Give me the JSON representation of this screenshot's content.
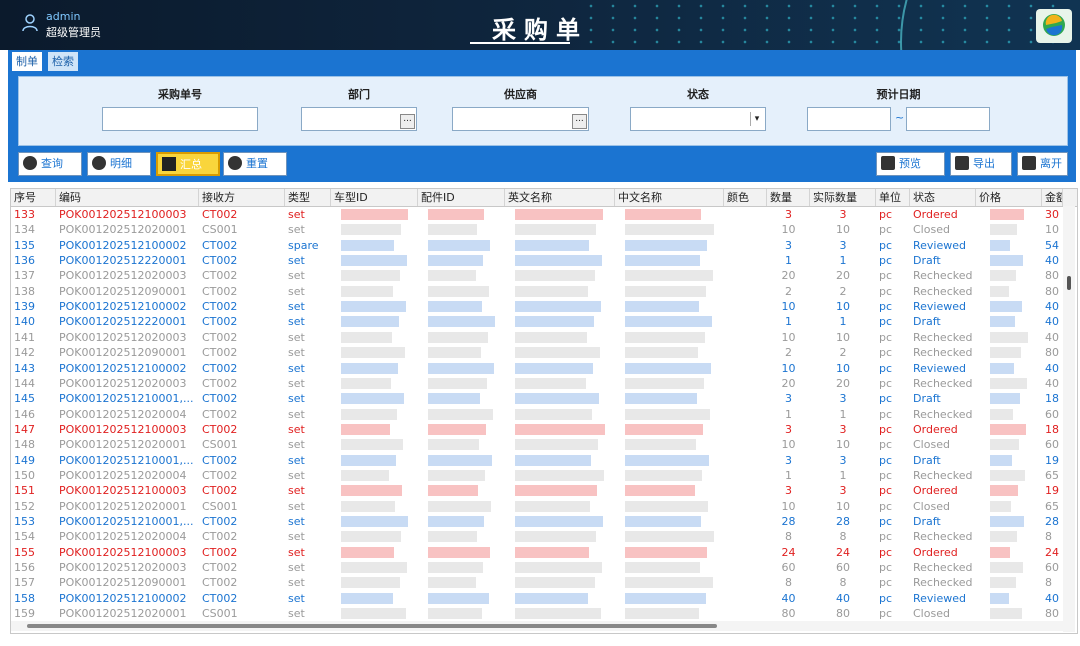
{
  "header": {
    "user_name": "admin",
    "user_role": "超级管理员",
    "title": "采购单"
  },
  "tabs": [
    {
      "label": "制单",
      "active": true
    },
    {
      "label": "检索",
      "active": false
    }
  ],
  "filters": {
    "purchase_no_label": "采购单号",
    "department_label": "部门",
    "supplier_label": "供应商",
    "status_label": "状态",
    "expected_date_label": "预计日期",
    "date_separator": "~",
    "browse_glyph": "...",
    "dropdown_glyph": "▾"
  },
  "toolbar": {
    "query": "查询",
    "detail": "明细",
    "summary": "汇总",
    "reset": "重置",
    "preview": "预览",
    "export": "导出",
    "leave": "离开"
  },
  "columns": [
    "序号",
    "编码",
    "接收方",
    "类型",
    "车型ID",
    "配件ID",
    "英文名称",
    "中文名称",
    "颜色",
    "数量",
    "实际数量",
    "单位",
    "状态",
    "价格",
    "金额"
  ],
  "rows": [
    {
      "no": "133",
      "code": "POK001202512100003",
      "recv": "CT002",
      "type": "set",
      "qty": "3",
      "actual": "3",
      "unit": "pc",
      "status": "Ordered",
      "amount": "30",
      "color": "red"
    },
    {
      "no": "134",
      "code": "POK001202512020001",
      "recv": "CS001",
      "type": "set",
      "qty": "10",
      "actual": "10",
      "unit": "pc",
      "status": "Closed",
      "amount": "10",
      "color": "gray"
    },
    {
      "no": "135",
      "code": "POK001202512100002",
      "recv": "CT002",
      "type": "spare",
      "qty": "3",
      "actual": "3",
      "unit": "pc",
      "status": "Reviewed",
      "amount": "54",
      "color": "blue"
    },
    {
      "no": "136",
      "code": "POK001202512220001",
      "recv": "CT002",
      "type": "set",
      "qty": "1",
      "actual": "1",
      "unit": "pc",
      "status": "Draft",
      "amount": "40",
      "color": "blue"
    },
    {
      "no": "137",
      "code": "POK001202512020003",
      "recv": "CT002",
      "type": "set",
      "qty": "20",
      "actual": "20",
      "unit": "pc",
      "status": "Rechecked",
      "amount": "80",
      "color": "gray"
    },
    {
      "no": "138",
      "code": "POK001202512090001",
      "recv": "CT002",
      "type": "set",
      "qty": "2",
      "actual": "2",
      "unit": "pc",
      "status": "Rechecked",
      "amount": "80",
      "color": "gray"
    },
    {
      "no": "139",
      "code": "POK001202512100002",
      "recv": "CT002",
      "type": "set",
      "qty": "10",
      "actual": "10",
      "unit": "pc",
      "status": "Reviewed",
      "amount": "40",
      "color": "blue"
    },
    {
      "no": "140",
      "code": "POK001202512220001",
      "recv": "CT002",
      "type": "set",
      "qty": "1",
      "actual": "1",
      "unit": "pc",
      "status": "Draft",
      "amount": "40",
      "color": "blue"
    },
    {
      "no": "141",
      "code": "POK001202512020003",
      "recv": "CT002",
      "type": "set",
      "qty": "10",
      "actual": "10",
      "unit": "pc",
      "status": "Rechecked",
      "amount": "40",
      "color": "gray"
    },
    {
      "no": "142",
      "code": "POK001202512090001",
      "recv": "CT002",
      "type": "set",
      "qty": "2",
      "actual": "2",
      "unit": "pc",
      "status": "Rechecked",
      "amount": "80",
      "color": "gray"
    },
    {
      "no": "143",
      "code": "POK001202512100002",
      "recv": "CT002",
      "type": "set",
      "qty": "10",
      "actual": "10",
      "unit": "pc",
      "status": "Reviewed",
      "amount": "40",
      "color": "blue"
    },
    {
      "no": "144",
      "code": "POK001202512020003",
      "recv": "CT002",
      "type": "set",
      "qty": "20",
      "actual": "20",
      "unit": "pc",
      "status": "Rechecked",
      "amount": "40",
      "color": "gray"
    },
    {
      "no": "145",
      "code": "POK00120251210001,...",
      "recv": "CT002",
      "type": "set",
      "qty": "3",
      "actual": "3",
      "unit": "pc",
      "status": "Draft",
      "amount": "18",
      "color": "blue"
    },
    {
      "no": "146",
      "code": "POK001202512020004",
      "recv": "CT002",
      "type": "set",
      "qty": "1",
      "actual": "1",
      "unit": "pc",
      "status": "Rechecked",
      "amount": "60",
      "color": "gray"
    },
    {
      "no": "147",
      "code": "POK001202512100003",
      "recv": "CT002",
      "type": "set",
      "qty": "3",
      "actual": "3",
      "unit": "pc",
      "status": "Ordered",
      "amount": "18",
      "color": "red"
    },
    {
      "no": "148",
      "code": "POK001202512020001",
      "recv": "CS001",
      "type": "set",
      "qty": "10",
      "actual": "10",
      "unit": "pc",
      "status": "Closed",
      "amount": "60",
      "color": "gray"
    },
    {
      "no": "149",
      "code": "POK00120251210001,...",
      "recv": "CT002",
      "type": "set",
      "qty": "3",
      "actual": "3",
      "unit": "pc",
      "status": "Draft",
      "amount": "19",
      "color": "blue"
    },
    {
      "no": "150",
      "code": "POK001202512020004",
      "recv": "CT002",
      "type": "set",
      "qty": "1",
      "actual": "1",
      "unit": "pc",
      "status": "Rechecked",
      "amount": "65",
      "color": "gray"
    },
    {
      "no": "151",
      "code": "POK001202512100003",
      "recv": "CT002",
      "type": "set",
      "qty": "3",
      "actual": "3",
      "unit": "pc",
      "status": "Ordered",
      "amount": "19",
      "color": "red"
    },
    {
      "no": "152",
      "code": "POK001202512020001",
      "recv": "CS001",
      "type": "set",
      "qty": "10",
      "actual": "10",
      "unit": "pc",
      "status": "Closed",
      "amount": "65",
      "color": "gray"
    },
    {
      "no": "153",
      "code": "POK00120251210001,...",
      "recv": "CT002",
      "type": "set",
      "qty": "28",
      "actual": "28",
      "unit": "pc",
      "status": "Draft",
      "amount": "28",
      "color": "blue"
    },
    {
      "no": "154",
      "code": "POK001202512020004",
      "recv": "CT002",
      "type": "set",
      "qty": "8",
      "actual": "8",
      "unit": "pc",
      "status": "Rechecked",
      "amount": "8",
      "color": "gray"
    },
    {
      "no": "155",
      "code": "POK001202512100003",
      "recv": "CT002",
      "type": "set",
      "qty": "24",
      "actual": "24",
      "unit": "pc",
      "status": "Ordered",
      "amount": "24",
      "color": "red"
    },
    {
      "no": "156",
      "code": "POK001202512020003",
      "recv": "CT002",
      "type": "set",
      "qty": "60",
      "actual": "60",
      "unit": "pc",
      "status": "Rechecked",
      "amount": "60",
      "color": "gray"
    },
    {
      "no": "157",
      "code": "POK001202512090001",
      "recv": "CT002",
      "type": "set",
      "qty": "8",
      "actual": "8",
      "unit": "pc",
      "status": "Rechecked",
      "amount": "8",
      "color": "gray"
    },
    {
      "no": "158",
      "code": "POK001202512100002",
      "recv": "CT002",
      "type": "set",
      "qty": "40",
      "actual": "40",
      "unit": "pc",
      "status": "Reviewed",
      "amount": "40",
      "color": "blue"
    },
    {
      "no": "159",
      "code": "POK001202512020001",
      "recv": "CS001",
      "type": "set",
      "qty": "80",
      "actual": "80",
      "unit": "pc",
      "status": "Closed",
      "amount": "80",
      "color": "gray"
    }
  ],
  "colors": {
    "red": "#e02020",
    "blue": "#1b74d1",
    "gray": "#9a9a9a",
    "accent": "#1b74d1",
    "summary_button": "#f9d53c"
  }
}
